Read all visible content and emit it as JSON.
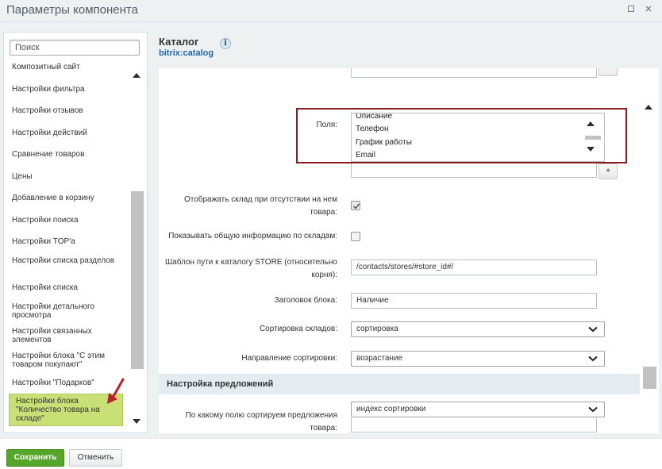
{
  "window": {
    "title": "Параметры компонента",
    "minimize_icon": "square-icon",
    "close_icon": "close-icon"
  },
  "sidebar": {
    "search_placeholder": "Поиск",
    "items": [
      {
        "label": "Композитный сайт"
      },
      {
        "label": "Настройки фильтра"
      },
      {
        "label": "Настройки отзывов"
      },
      {
        "label": "Настройки действий"
      },
      {
        "label": "Сравнение товаров"
      },
      {
        "label": "Цены"
      },
      {
        "label": "Добавление в корзину"
      },
      {
        "label": "Настройки поиска"
      },
      {
        "label": "Настройки TOP'а"
      },
      {
        "label": "Настройки списка разделов"
      },
      {
        "label": "Настройки списка"
      },
      {
        "label": "Настройки детального просмотра"
      },
      {
        "label": "Настройки связанных элементов"
      },
      {
        "label": "Настройки блока \"С этим товаром покупают\""
      },
      {
        "label": "Настройки \"Подарков\""
      },
      {
        "label": "Настройки блока \"Количество товара на складе\"",
        "active": true
      }
    ]
  },
  "component": {
    "title": "Каталог",
    "code": "bitrix:catalog"
  },
  "form": {
    "fields_label": "Поля:",
    "fields_options": [
      "Описание",
      "Телефон",
      "График работы",
      "Email"
    ],
    "plus_label": "+",
    "show_store_label": "Отображать склад при отсутствии на нем товара:",
    "show_store_checked": true,
    "show_general_label": "Показывать общую информацию по складам:",
    "show_general_checked": false,
    "path_template_label": "Шаблон пути к каталогу STORE (относительно корня):",
    "path_template_value": "/contacts/stores/#store_id#/",
    "block_title_label": "Заголовок блока:",
    "block_title_value": "Наличие",
    "sort_stores_label": "Сортировка складов:",
    "sort_stores_value": "сортировка",
    "sort_direction_label": "Направление сортировки:",
    "sort_direction_value": "возрастание",
    "offers_section_title": "Настройка предложений",
    "offers_sort_label": "По какому полю сортируем предложения товара:",
    "offers_sort_value": "индекс сортировки"
  },
  "footer": {
    "save_label": "Сохранить",
    "cancel_label": "Отменить"
  },
  "colors": {
    "active_item": "#c9e076",
    "save_button": "#56a62b",
    "highlight_border": "#8e1a22",
    "link_blue": "#2067b0"
  }
}
